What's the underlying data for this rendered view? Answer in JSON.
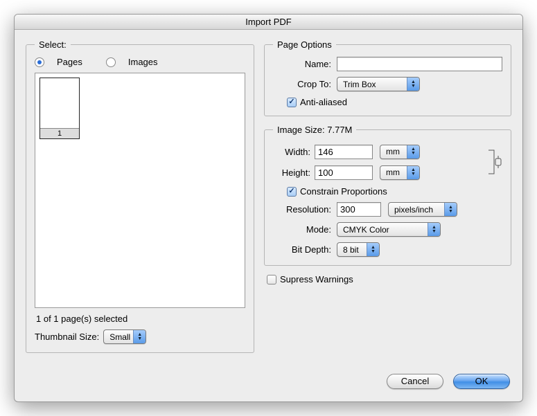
{
  "title": "Import PDF",
  "select": {
    "legend": "Select:",
    "pages_label": "Pages",
    "images_label": "Images",
    "selected": "pages",
    "thumb_number": "1",
    "status": "1 of 1 page(s) selected",
    "thumb_size_label": "Thumbnail Size:",
    "thumb_size_value": "Small"
  },
  "page_options": {
    "legend": "Page Options",
    "name_label": "Name:",
    "name_value": "",
    "crop_label": "Crop To:",
    "crop_value": "Trim Box",
    "antialiased_checked": true,
    "antialiased_label": "Anti-aliased"
  },
  "image_size": {
    "legend": "Image Size: 7.77M",
    "width_label": "Width:",
    "width_value": "146",
    "width_unit": "mm",
    "height_label": "Height:",
    "height_value": "100",
    "height_unit": "mm",
    "constrain_checked": true,
    "constrain_label": "Constrain Proportions",
    "resolution_label": "Resolution:",
    "resolution_value": "300",
    "resolution_unit": "pixels/inch",
    "mode_label": "Mode:",
    "mode_value": "CMYK Color",
    "bitdepth_label": "Bit Depth:",
    "bitdepth_value": "8 bit"
  },
  "suppress": {
    "checked": false,
    "label": "Supress Warnings"
  },
  "buttons": {
    "cancel": "Cancel",
    "ok": "OK"
  }
}
